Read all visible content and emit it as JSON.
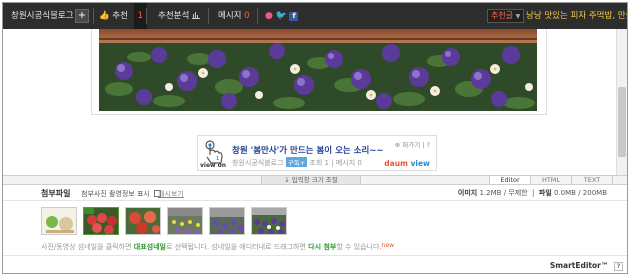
{
  "topbar": {
    "blog_name": "창원시공식블로그",
    "add_label": "+",
    "recommend_label": "추천",
    "recommend_count": "1",
    "analysis_label": "추천분석",
    "message_label": "메시지",
    "message_count": "0",
    "recommend_select": "추천글",
    "notice_text": "낭낭 맛있는 피자 주먹밥, 만들기 쉬워요"
  },
  "viewon": {
    "logo_text": "view on",
    "title": "창원 '봄만사'가 만드는 봄이 오는 소리~~",
    "author": "창원시공식블로그",
    "tag": "구독+",
    "views_label": "조회",
    "views": "1",
    "message_label": "메시지",
    "message_count": "0",
    "top_right": "⊕ 퍼가기  |  ?",
    "brand_prefix": "daum",
    "brand_suffix": "view"
  },
  "mode_tabs": [
    {
      "label": "Editor",
      "active": true
    },
    {
      "label": "HTML",
      "active": false
    },
    {
      "label": "TEXT",
      "active": false
    }
  ],
  "resize_label": "↓ 입력창 크기 조절",
  "attach": {
    "title": "첨부파일",
    "exif_option": "첨부사진 촬영정보 표시",
    "show_link": "캐시보기",
    "image_label": "이미지",
    "image_size": "1.2MB",
    "image_limit": "무제한",
    "file_label": "파일",
    "file_size": "0.0MB",
    "file_limit": "200MB",
    "help_prefix": "사진/동영상 섬네일을 클릭하면",
    "help_highlight1": "대표섬네일",
    "help_middle": "로 선택됩니다. 섬네일을 에디터내로 드래그하면",
    "help_highlight2": "다시 첨부",
    "help_suffix": "할 수 있습니다.",
    "help_new": "new"
  },
  "footer": {
    "brand": "SmartEditor™",
    "help": "?"
  }
}
